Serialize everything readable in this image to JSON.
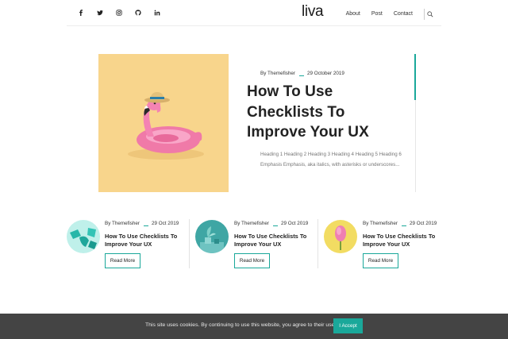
{
  "header": {
    "social": [
      {
        "icon": "facebook-icon"
      },
      {
        "icon": "twitter-icon"
      },
      {
        "icon": "instagram-icon"
      },
      {
        "icon": "github-icon"
      },
      {
        "icon": "linkedin-icon"
      }
    ],
    "logo": "liva",
    "nav": [
      "About",
      "Post",
      "Contact"
    ],
    "search_icon": "search-icon"
  },
  "hero": {
    "author": "By Themefisher",
    "date": "29 October 2019",
    "title": "How To Use Checklists To Improve Your UX",
    "excerpt": "Heading 1 Heading 2 Heading 3 Heading 4 Heading 5 Heading 6 Emphasis Emphasis, aka italics, with asterisks or underscores...",
    "accent_color": "#1aa89a"
  },
  "cards": [
    {
      "author": "By Themefisher",
      "date": "29 Oct 2019",
      "title": "How To Use Checklists To Improve Your UX",
      "button": "Read More",
      "thumb_color": "#bff0ea"
    },
    {
      "author": "By Themefisher",
      "date": "29 Oct 2019",
      "title": "How To Use Checklists To Improve Your UX",
      "button": "Read More",
      "thumb_color": "#3fa6a4"
    },
    {
      "author": "By Themefisher",
      "date": "29 Oct 2019",
      "title": "How To Use Checklists To Improve Your UX",
      "button": "Read More",
      "thumb_color": "#f2dc62"
    }
  ],
  "cookie": {
    "text": "This site uses cookies. By continuing to use this website, you agree to their use.",
    "button": "I Accept"
  }
}
